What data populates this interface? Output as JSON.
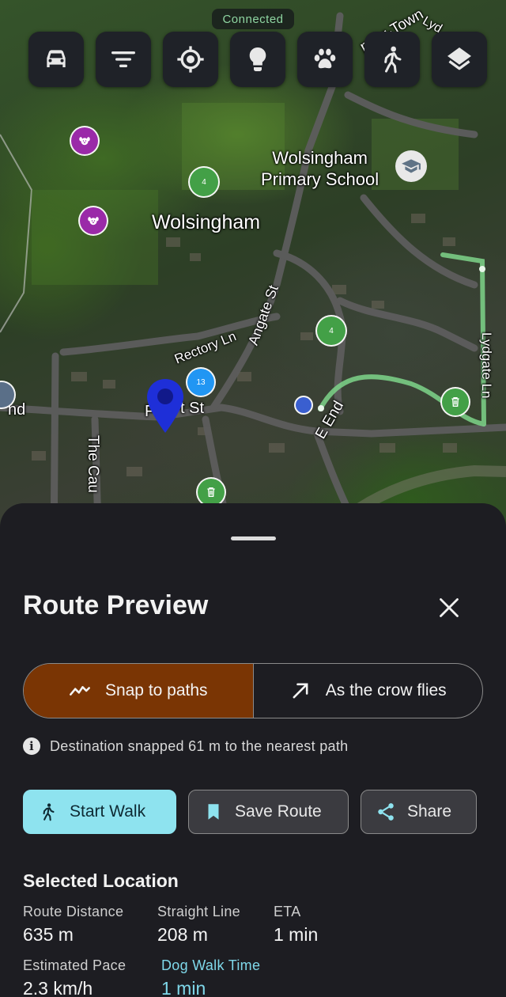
{
  "status": {
    "connection": "Connected"
  },
  "toolbar": {
    "buttons": [
      {
        "name": "car",
        "icon": "car-icon"
      },
      {
        "name": "filter",
        "icon": "filter-icon"
      },
      {
        "name": "locate",
        "icon": "my-location-icon"
      },
      {
        "name": "tips",
        "icon": "lightbulb-icon"
      },
      {
        "name": "pets",
        "icon": "paw-icon"
      },
      {
        "name": "walk",
        "icon": "walking-icon"
      },
      {
        "name": "layers",
        "icon": "layers-icon"
      }
    ]
  },
  "map": {
    "labels": {
      "town": "Wolsingham",
      "school_line1": "Wolsingham",
      "school_line2": "Primary School",
      "rectory": "Rectory Ln",
      "angate": "Angate St",
      "front": "F",
      "front2": "t St",
      "eend": "E End",
      "causeway": "The Cau",
      "nd": "nd",
      "lydgate": "Lydgate Ln",
      "uppertown": "pper-Town",
      "lyd": "Lyd"
    },
    "markers": {
      "cluster_a": "4",
      "cluster_b": "4",
      "cluster_c": "13"
    }
  },
  "sheet": {
    "title": "Route Preview",
    "mode": {
      "snap_label": "Snap to paths",
      "crow_label": "As the crow flies",
      "selected": "snap"
    },
    "info": "Destination snapped 61 m to the nearest path",
    "actions": {
      "start": "Start Walk",
      "save": "Save Route",
      "share": "Share"
    },
    "selected_location": {
      "title": "Selected Location",
      "route_distance_label": "Route Distance",
      "route_distance_value": "635 m",
      "straight_line_label": "Straight Line",
      "straight_line_value": "208 m",
      "eta_label": "ETA",
      "eta_value": "1 min",
      "pace_label": "Estimated Pace",
      "pace_value": "2.3 km/h",
      "dog_time_label": "Dog Walk Time",
      "dog_time_value": "1 min"
    }
  },
  "colors": {
    "accent_active": "#7a3504",
    "start_button": "#8ee3ef",
    "route_line": "#7ed58a",
    "pin": "#1e2fd8"
  }
}
